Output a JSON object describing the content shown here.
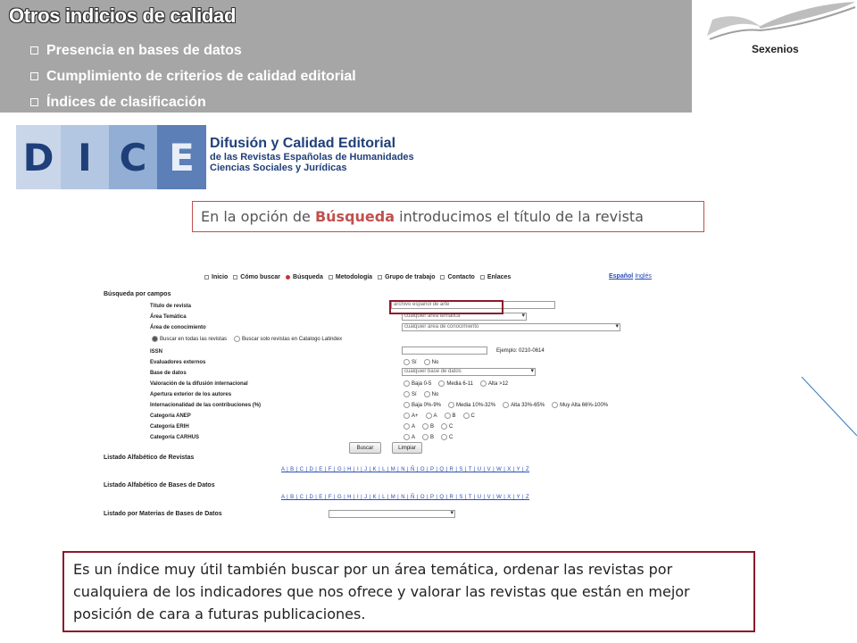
{
  "header": {
    "title": "Otros indicios de calidad",
    "items": [
      {
        "label": "Presencia en bases de datos"
      },
      {
        "label": "Cumplimiento de criterios de calidad editorial"
      },
      {
        "label": "Índices de clasificación"
      }
    ]
  },
  "brand": {
    "label": "Sexenios"
  },
  "dice": {
    "letters": [
      "D",
      "I",
      "C",
      "E"
    ],
    "title": "Difusión y Calidad Editorial",
    "line2": "de las Revistas Españolas de Humanidades",
    "line3": "Ciencias Sociales y Jurídicas"
  },
  "callout": {
    "before": "En la opción de ",
    "keyword": "Búsqueda",
    "after": " introducimos el título de la revista"
  },
  "web": {
    "nav": [
      "Inicio",
      "Cómo buscar",
      "Búsqueda",
      "Metodología",
      "Grupo de trabajo",
      "Contacto",
      "Enlaces"
    ],
    "lang_es": "Español",
    "lang_en": "Inglés",
    "form_title": "Búsqueda por campos",
    "labels": {
      "titulo": "Título de revista",
      "area_tematica": "Área Temática",
      "area_conocimiento": "Área de conocimiento",
      "issn": "ISSN",
      "evaluadores": "Evaluadores externos",
      "base_datos": "Base de datos",
      "valoracion": "Valoración de la difusión internacional",
      "apertura": "Apertura exterior de los autores",
      "internacionalidad": "Internacionalidad de las contribuciones (%)",
      "anep": "Categoría ANEP",
      "erih": "Categoría ERIH",
      "carhus": "Categoría CARHUS"
    },
    "values": {
      "titulo": "archivo español de arte",
      "area_tematica": "cualquier área temática",
      "area_conocimiento": "cualquier área de conocimiento",
      "base_datos": "cualquier base de datos"
    },
    "search_scope": [
      "Buscar en todas las revistas",
      "Buscar solo revistas en Catalogo Latindex"
    ],
    "issn_hint": "Ejemplo: 0210-0614",
    "yes_no": [
      "Sí",
      "No"
    ],
    "valoracion_opts": [
      "Baja 0-5",
      "Media 6-11",
      "Alta >12"
    ],
    "internacionalidad_opts": [
      "Baja 0%-9%",
      "Media 10%-32%",
      "Alta 33%-65%",
      "Muy Alta 66%-100%"
    ],
    "anep_opts": [
      "A+",
      "A",
      "B",
      "C"
    ],
    "erih_opts": [
      "A",
      "B",
      "C"
    ],
    "carhus_opts": [
      "A",
      "B",
      "C"
    ],
    "btn_search": "Buscar",
    "btn_clear": "Limpiar",
    "list_revistas": "Listado Alfabético de Revistas",
    "list_bases": "Listado Alfabético de Bases de Datos",
    "list_materias": "Listado por Materias de Bases de Datos",
    "alphabet": "A | B | C | D | E | F | G | H | I | J | K | L | M | N | Ñ | O | P | Q | R | S | T | U | V | W | X | Y | Z"
  },
  "note": {
    "text": "Es un índice muy útil también buscar por un área temática, ordenar las revistas por cualquiera de los indicadores que nos ofrece y valorar las revistas que están en mejor posición de cara a futuras publicaciones."
  },
  "colors": {
    "header_bg": "#a6a6a6",
    "accent_red": "#c0504d",
    "frame_red": "#8b1a2b",
    "dice_blue": "#1f3f7a"
  }
}
